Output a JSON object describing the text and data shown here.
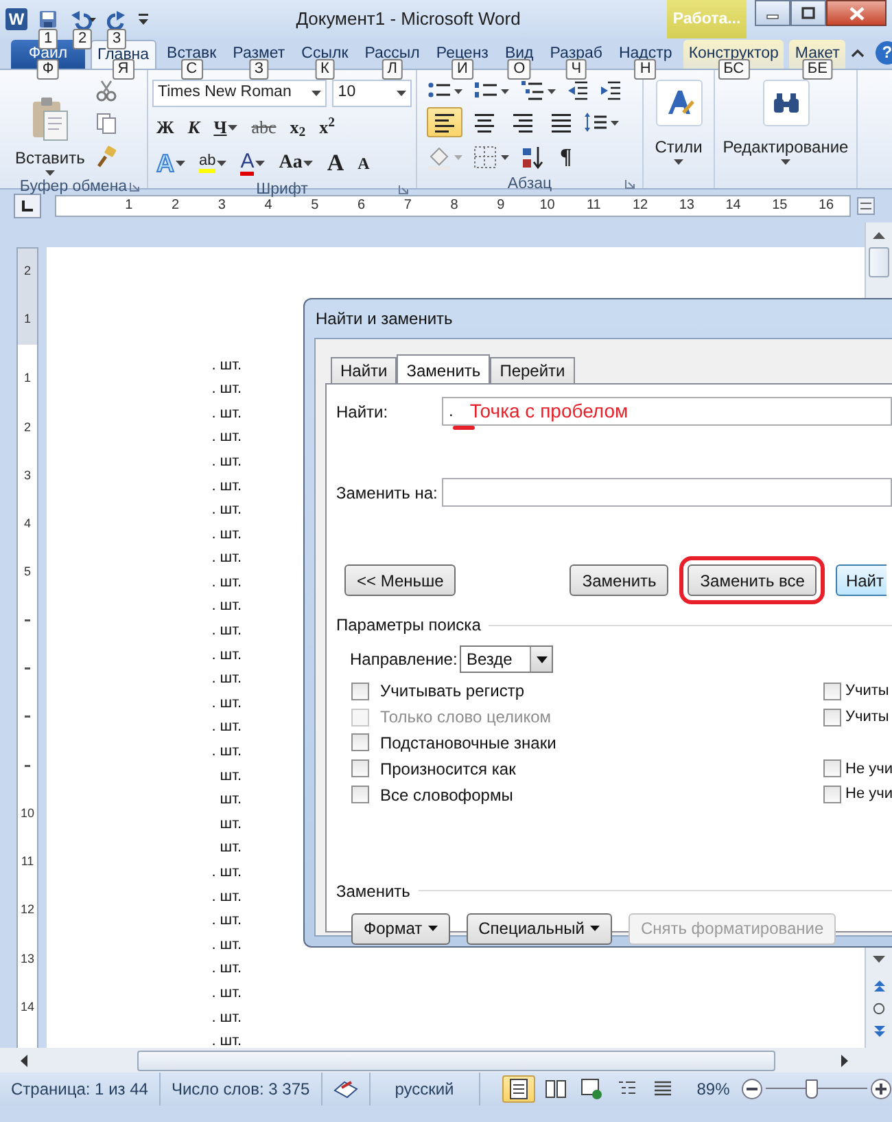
{
  "window": {
    "app_icon": "W",
    "title": "Документ1  -  Microsoft Word",
    "contextual_group": "Работа...",
    "help": "?"
  },
  "quick_access": [
    {
      "kind": "save",
      "keytip": "1"
    },
    {
      "kind": "undo",
      "keytip": "2"
    },
    {
      "kind": "redo",
      "keytip": "3"
    }
  ],
  "ribbon_tabs": [
    {
      "label": "Файл",
      "kind": "file",
      "keytip": "Ф",
      "selected": false
    },
    {
      "label": "Главна",
      "kind": "normal",
      "keytip": "Я",
      "selected": true
    },
    {
      "label": "Вставк",
      "kind": "normal",
      "keytip": "С",
      "selected": false
    },
    {
      "label": "Размет",
      "kind": "normal",
      "keytip": "З",
      "selected": false
    },
    {
      "label": "Ссылк",
      "kind": "normal",
      "keytip": "К",
      "selected": false
    },
    {
      "label": "Рассыл",
      "kind": "normal",
      "keytip": "Л",
      "selected": false
    },
    {
      "label": "Реценз",
      "kind": "normal",
      "keytip": "И",
      "selected": false
    },
    {
      "label": "Вид",
      "kind": "normal",
      "keytip": "О",
      "selected": false
    },
    {
      "label": "Разраб",
      "kind": "normal",
      "keytip": "Ч",
      "selected": false
    },
    {
      "label": "Надстр",
      "kind": "normal",
      "keytip": "Н",
      "selected": false
    },
    {
      "label": "Конструктор",
      "kind": "contextual",
      "keytip": "БС",
      "selected": false
    },
    {
      "label": "Макет",
      "kind": "contextual",
      "keytip": "БЕ",
      "selected": false
    }
  ],
  "ribbon": {
    "clipboard": {
      "label": "Буфер обмена",
      "paste": "Вставить"
    },
    "font": {
      "label": "Шрифт",
      "font_name": "Times New Roman",
      "font_size": "10",
      "format_buttons": [
        {
          "text": "Ж",
          "kind": "bold"
        },
        {
          "text": "К",
          "kind": "italic"
        },
        {
          "text": "Ч",
          "kind": "underline"
        },
        {
          "text": "abc",
          "kind": "strike"
        },
        {
          "text": "x$_{2}$",
          "kind": "plain"
        },
        {
          "text": "x$^{2}$",
          "kind": "plain"
        }
      ],
      "effect_buttons": [
        {
          "text": "A",
          "kind": "effects"
        },
        {
          "text": "ab",
          "kind": "highlight"
        },
        {
          "text": "A",
          "kind": "color"
        },
        {
          "text": "Aa",
          "kind": "case"
        },
        {
          "text": "A",
          "kind": "grow"
        },
        {
          "text": "A",
          "kind": "shrink"
        }
      ]
    },
    "paragraph": {
      "label": "Абзац",
      "alignments": [
        {
          "kind": "left",
          "selected": true
        },
        {
          "kind": "center",
          "selected": false
        },
        {
          "kind": "right",
          "selected": false
        },
        {
          "kind": "justify",
          "selected": false
        }
      ],
      "pilcrow": "¶"
    },
    "styles": {
      "label": "Стили"
    },
    "editing": {
      "label": "Редактирование"
    }
  },
  "ruler": {
    "numbers": [
      "1",
      "2",
      "3",
      "4",
      "5",
      "6",
      "7",
      "8",
      "9",
      "10",
      "11",
      "12",
      "13",
      "14",
      "15",
      "16"
    ]
  },
  "vertical_ruler": {
    "top_numbers": [
      "2",
      "1"
    ],
    "slots": [
      {
        "kind": "number",
        "label": "1"
      },
      {
        "kind": "number",
        "label": "2"
      },
      {
        "kind": "number",
        "label": "3"
      },
      {
        "kind": "number",
        "label": "4"
      },
      {
        "kind": "number",
        "label": "5"
      },
      {
        "kind": "tick"
      },
      {
        "kind": "tick"
      },
      {
        "kind": "tick"
      },
      {
        "kind": "tick"
      },
      {
        "kind": "number",
        "label": "10"
      },
      {
        "kind": "number",
        "label": "11"
      },
      {
        "kind": "number",
        "label": "12"
      },
      {
        "kind": "number",
        "label": "13"
      },
      {
        "kind": "number",
        "label": "14"
      }
    ]
  },
  "document": {
    "lines": [
      ". шт.",
      ". шт.",
      ". шт.",
      ". шт.",
      ". шт.",
      ". шт.",
      ". шт.",
      ". шт.",
      ". шт.",
      ". шт.",
      ". шт.",
      ". шт.",
      ". шт.",
      ". шт.",
      ". шт.",
      ". шт.",
      ". шт.",
      "шт.",
      "шт.",
      "шт.",
      "шт.",
      ". шт.",
      ". шт.",
      ". шт.",
      ". шт.",
      ". шт.",
      ". шт.",
      ". шт.",
      ". шт."
    ]
  },
  "dialog": {
    "title": "Найти и заменить",
    "tabs": [
      {
        "label": "Найти",
        "selected": false
      },
      {
        "label": "Заменить",
        "selected": true
      },
      {
        "label": "Перейти",
        "selected": false
      }
    ],
    "find": {
      "label": "Найти:",
      "value": ".",
      "annotation": "Точка с пробелом"
    },
    "replace": {
      "label": "Заменить на:"
    },
    "buttons": [
      {
        "label": "<< Меньше",
        "kind": "left",
        "highlighted": false
      },
      {
        "label": "Заменить",
        "kind": "right",
        "highlighted": false
      },
      {
        "label": "Заменить все",
        "kind": "right",
        "highlighted": true
      },
      {
        "label": "Найт",
        "kind": "default",
        "highlighted": false
      }
    ],
    "search_options": {
      "label": "Параметры поиска",
      "direction_label": "Направление:",
      "direction": "Везде",
      "rows": [
        {
          "left": {
            "label": "Учитывать регистр",
            "checked": false,
            "disabled": false
          },
          "right": {
            "label": "Учиты",
            "checked": false,
            "disabled": false
          }
        },
        {
          "left": {
            "label": "Только слово целиком",
            "checked": false,
            "disabled": true
          },
          "right": {
            "label": "Учиты",
            "checked": false,
            "disabled": false
          }
        },
        {
          "left": {
            "label": "Подстановочные знаки",
            "checked": false,
            "disabled": false
          }
        },
        {
          "left": {
            "label": "Произносится как",
            "checked": false,
            "disabled": false
          },
          "right": {
            "label": "Не учи",
            "checked": false,
            "disabled": false
          }
        },
        {
          "left": {
            "label": "Все словоформы",
            "checked": false,
            "disabled": false
          },
          "right": {
            "label": "Не учи",
            "checked": false,
            "disabled": false
          }
        }
      ]
    },
    "replace_section": {
      "label": "Заменить",
      "buttons": [
        {
          "label": "Формат",
          "dropdown": true,
          "disabled": false
        },
        {
          "label": "Специальный",
          "dropdown": true,
          "disabled": false
        },
        {
          "label": "Снять форматирование",
          "dropdown": false,
          "disabled": true
        }
      ]
    }
  },
  "status_bar": {
    "page": "Страница: 1 из 44",
    "words": "Число слов: 3 375",
    "language": "русский",
    "views": [
      {
        "kind": "print",
        "selected": true
      },
      {
        "kind": "reading",
        "selected": false
      },
      {
        "kind": "web",
        "selected": false
      },
      {
        "kind": "outline",
        "selected": false
      },
      {
        "kind": "draft",
        "selected": false
      }
    ],
    "zoom": "89%",
    "zoom_slider": {
      "level": 0.45
    }
  }
}
